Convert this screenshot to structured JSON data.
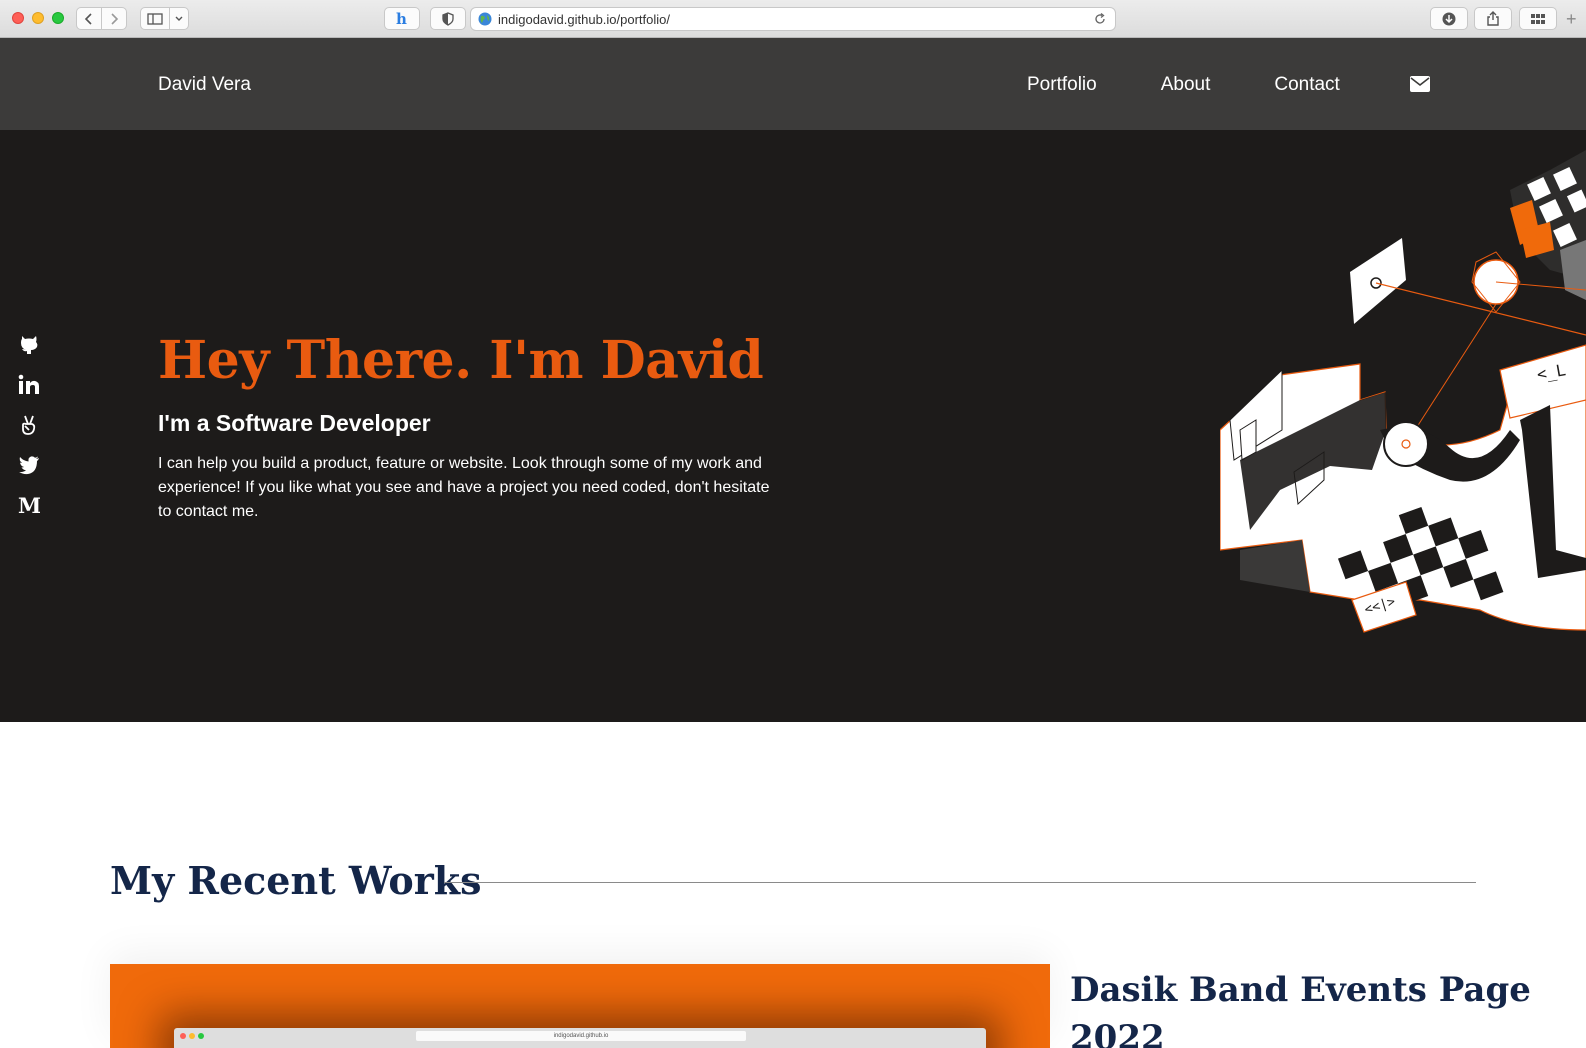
{
  "browser": {
    "url": "indigodavid.github.io/portfolio/"
  },
  "nav": {
    "brand": "David Vera",
    "links": [
      "Portfolio",
      "About",
      "Contact"
    ],
    "mail_icon": "envelope-icon"
  },
  "social": {
    "icons": [
      "github-icon",
      "linkedin-icon",
      "angellist-icon",
      "twitter-icon",
      "medium-icon"
    ]
  },
  "hero": {
    "title": "Hey There. I'm David",
    "subtitle": "I'm a Software Developer",
    "description": "I can help you build a product, feature or website. Look through some of my work and experience! If you like what you see and have a project you need coded, don't hesitate to contact me."
  },
  "works": {
    "heading": "My Recent Works",
    "project_title": "Dasik Band Events Page 2022",
    "thumb_url": "indigodavid.github.io"
  },
  "colors": {
    "accent": "#e95b10",
    "nav_bg": "#3c3b3a",
    "hero_bg": "#1d1b1a",
    "heading": "#142649"
  }
}
